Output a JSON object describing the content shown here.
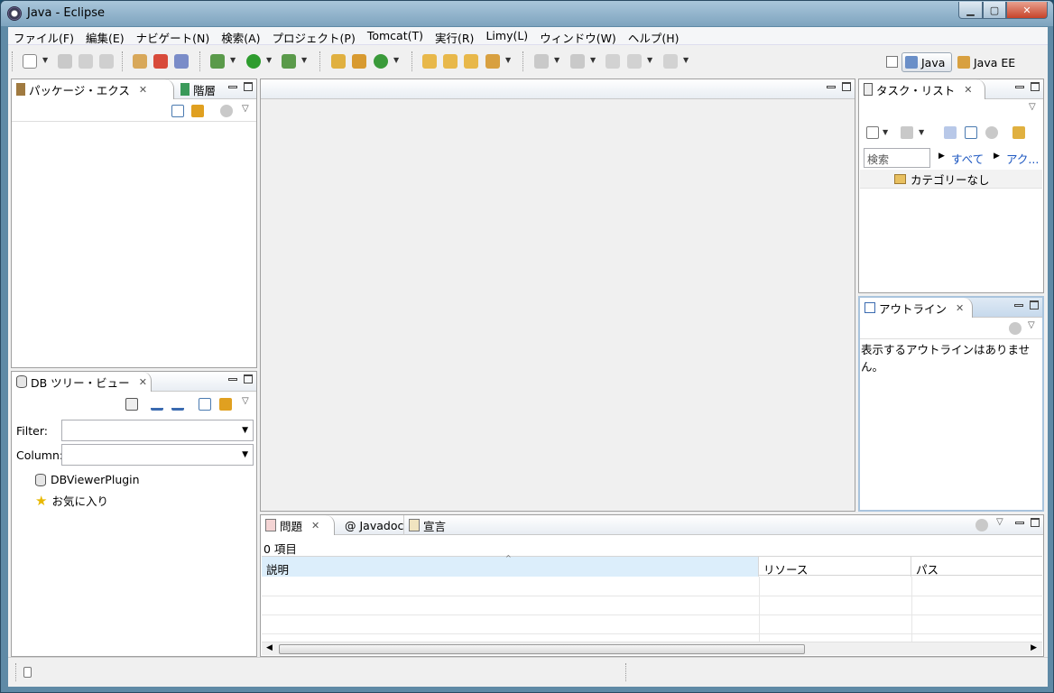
{
  "window": {
    "title": "Java - Eclipse"
  },
  "menu": [
    "ファイル(F)",
    "編集(E)",
    "ナビゲート(N)",
    "検索(A)",
    "プロジェクト(P)",
    "Tomcat(T)",
    "実行(R)",
    "Limy(L)",
    "ウィンドウ(W)",
    "ヘルプ(H)"
  ],
  "perspectives": {
    "java": "Java",
    "javaee": "Java EE"
  },
  "package_explorer": {
    "tab_label": "パッケージ・エクス",
    "second_tab": "階層"
  },
  "db_tree": {
    "tab_label": "DB ツリー・ビュー",
    "filter_label": "Filter:",
    "column_label": "Column:",
    "items": [
      "DBViewerPlugin",
      "お気に入り"
    ]
  },
  "task_list": {
    "tab_label": "タスク・リスト",
    "search_placeholder": "検索",
    "filter_all": "すべて",
    "filter_active": "アク...",
    "category": "カテゴリーなし"
  },
  "outline": {
    "tab_label": "アウトライン",
    "message": "表示するアウトラインはありません。"
  },
  "problems": {
    "tab_problems": "問題",
    "tab_javadoc": "Javadoc",
    "tab_declaration": "宣言",
    "count": "0 項目",
    "columns": [
      "説明",
      "リソース",
      "パス"
    ]
  },
  "colors": {
    "titlebar": "#7ea4bf",
    "accent": "#1a55c0",
    "selected_header": "#dceefb"
  }
}
